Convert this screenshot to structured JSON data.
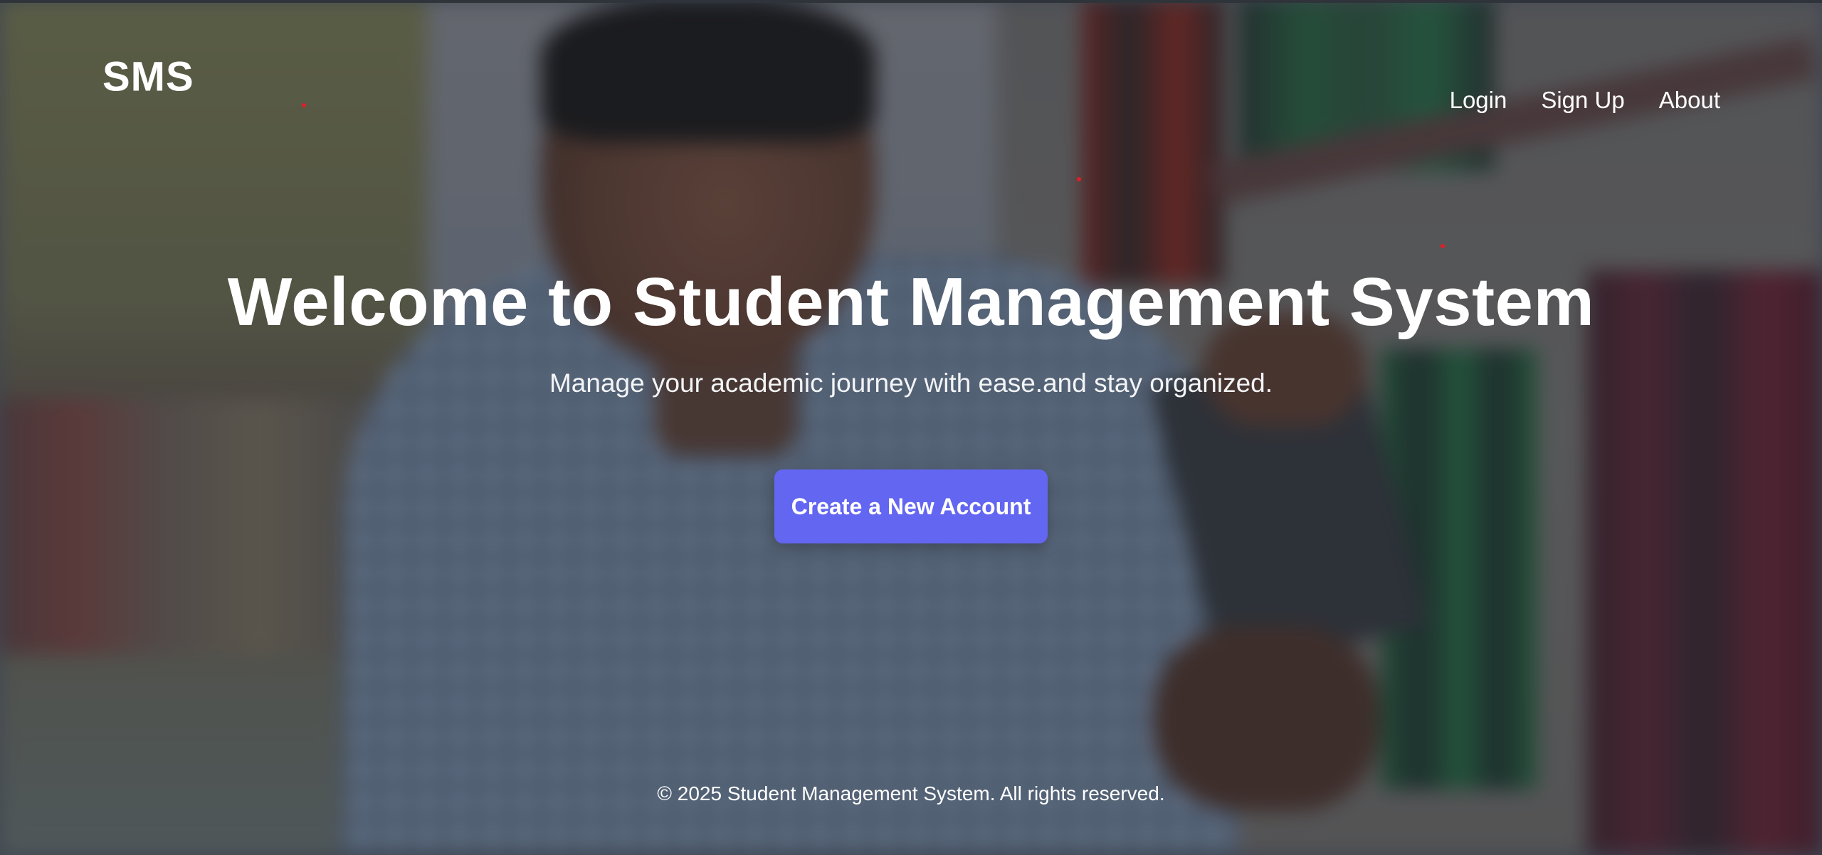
{
  "navbar": {
    "brand": "SMS",
    "links": [
      {
        "label": "Login"
      },
      {
        "label": "Sign Up"
      },
      {
        "label": "About"
      }
    ]
  },
  "hero": {
    "title": "Welcome to Student Management System",
    "subtitle": "Manage your academic journey with ease.and stay organized.",
    "cta_label": "Create a New Account"
  },
  "footer": {
    "text": "© 2025 Student Management System. All rights reserved."
  },
  "colors": {
    "accent": "#6366f1",
    "text": "#ffffff",
    "overlay": "rgba(25, 30, 40, 0.42)"
  }
}
